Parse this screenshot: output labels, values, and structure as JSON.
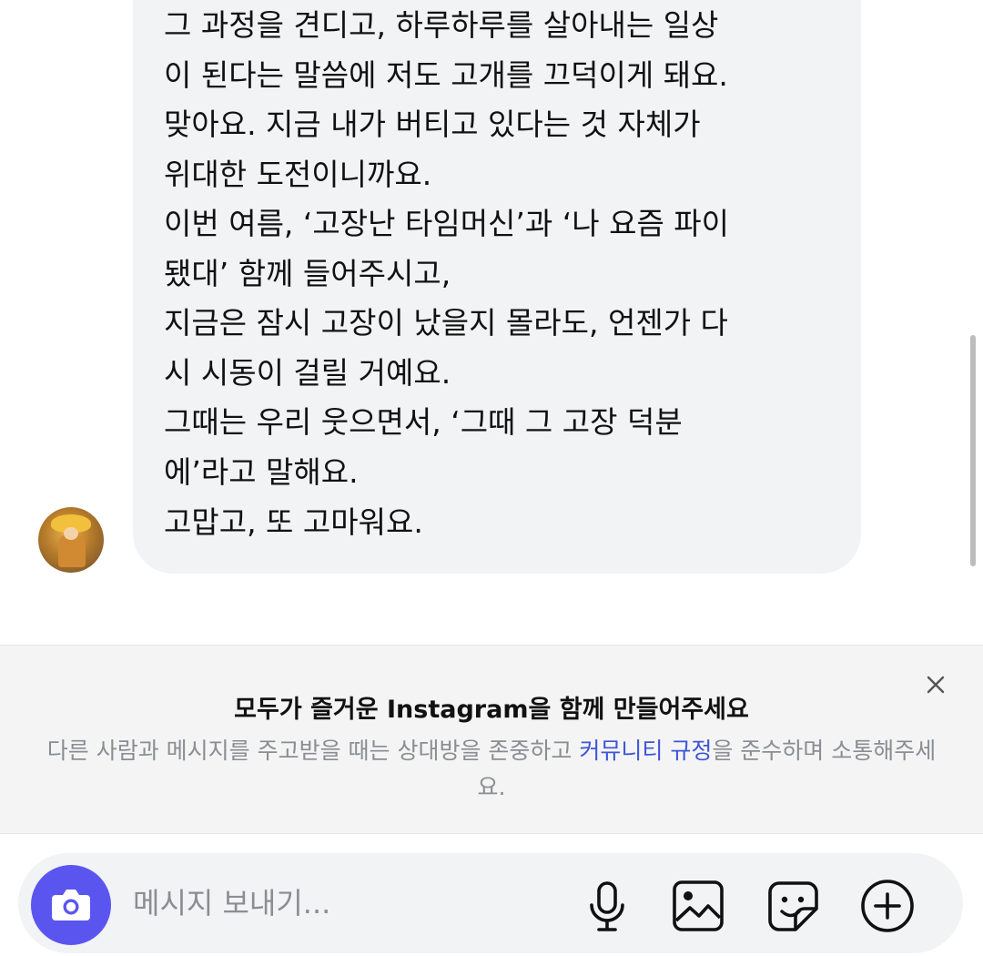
{
  "conversation": {
    "message_lines": [
      "그 과정을 견디고, 하루하루를 살아내는 일상",
      "이 된다는 말씀에 저도 고개를 끄덕이게 돼요.",
      "맞아요. 지금 내가 버티고 있다는 것 자체가",
      "위대한 도전이니까요.",
      "이번 여름, ‘고장난 타임머신’과 ‘나 요즘 파이",
      "됐대’ 함께 들어주시고,",
      "지금은 잠시 고장이 났을지 몰라도, 언젠가 다",
      "시 시동이 걸릴 거예요.",
      "그때는 우리 웃으면서, ‘그때 그 고장 덕분",
      "에’라고 말해요.",
      "고맙고, 또 고마워요."
    ]
  },
  "notice": {
    "title": "모두가 즐거운 Instagram을 함께 만들어주세요",
    "body_before": "다른 사람과 메시지를 주고받을 때는 상대방을 존중하고 ",
    "link": "커뮤니티 규정",
    "body_after": "을 준수하며 소통해주세요."
  },
  "composer": {
    "placeholder": "메시지 보내기..."
  },
  "icons": {
    "camera": "camera-icon",
    "microphone": "microphone-icon",
    "gallery": "image-icon",
    "sticker": "sticker-icon",
    "add": "plus-circle-icon",
    "close": "close-icon"
  },
  "colors": {
    "camera_button": "#5b55f0",
    "link": "#3d55d6",
    "bubble": "#f2f3f5",
    "muted_text": "#8a8d91"
  }
}
